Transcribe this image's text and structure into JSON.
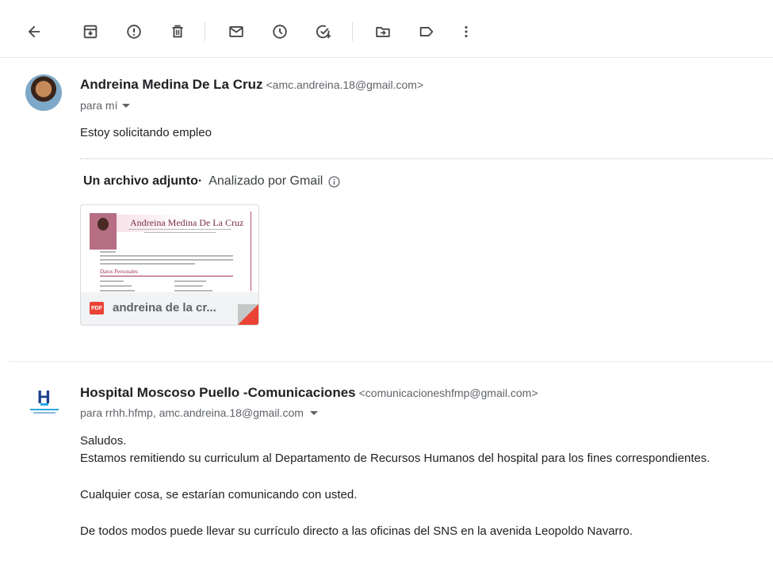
{
  "toolbar": {
    "back": "arrow-left-icon",
    "archive": "archive-icon",
    "spam": "report-spam-icon",
    "delete": "trash-icon",
    "mark_unread": "mail-icon",
    "snooze": "clock-icon",
    "add_task": "add-task-icon",
    "move_to": "move-to-folder-icon",
    "labels": "label-icon",
    "more": "more-vert-icon"
  },
  "messages": [
    {
      "sender_name": "Andreina Medina De La Cruz",
      "sender_email": "<amc.andreina.18@gmail.com>",
      "to": "para mí",
      "body": "Estoy solicitando empleo",
      "attachments_heading": "Un archivo adjunto",
      "scan_note": "Analizado por Gmail",
      "attachment": {
        "file_name": "andreina de la cr...",
        "type_badge": "PDF",
        "preview_title": "Andreina Medina De La Cruz",
        "preview_section": "Datos Personales"
      }
    },
    {
      "sender_name": "Hospital Moscoso Puello -Comunicaciones",
      "sender_email": "<comunicacioneshfmp@gmail.com>",
      "to": "para rrhh.hfmp, amc.andreina.18@gmail.com",
      "body_lines": [
        "Saludos.",
        "Estamos remitiendo su curriculum al Departamento de Recursos Humanos del hospital para los fines correspondientes.",
        "Cualquier cosa, se estarían comunicando con usted.",
        "De todos modos puede llevar su currículo directo a las oficinas del SNS en la avenida Leopoldo Navarro."
      ]
    }
  ],
  "colors": {
    "accent_red": "#ea4335",
    "icon_gray": "#444746",
    "logo_blue": "#1e3f8c"
  }
}
